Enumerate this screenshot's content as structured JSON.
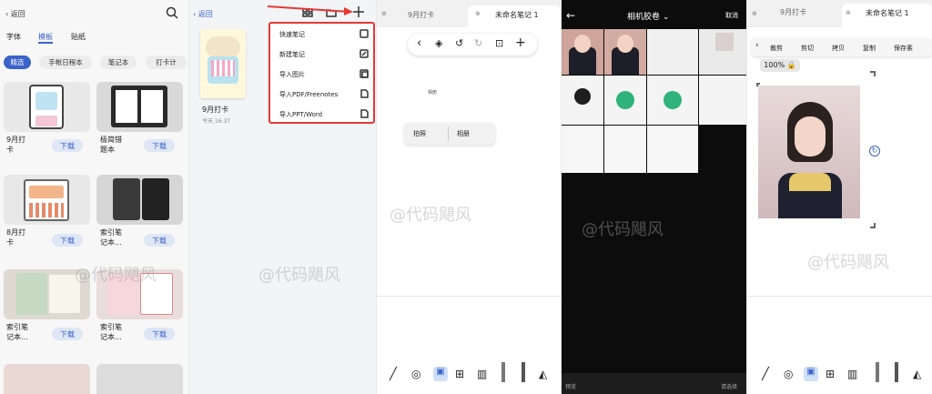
{
  "panel1": {
    "back": "返回",
    "tabs": [
      "字体",
      "模板",
      "贴纸"
    ],
    "chips": [
      "精选",
      "手帐日程本",
      "笔记本",
      "打卡计"
    ],
    "templates": [
      {
        "name": "9月打\n卡",
        "action": "下载"
      },
      {
        "name": "极简错\n题本",
        "action": "下载"
      },
      {
        "name": "8月打\n卡",
        "action": "下载"
      },
      {
        "name": "索引笔\n记本...",
        "action": "下载"
      },
      {
        "name": "索引笔\n记本...",
        "action": "下载"
      },
      {
        "name": "索引笔\n记本...",
        "action": "下载"
      }
    ]
  },
  "panel2": {
    "back": "返回",
    "note_title": "9月打卡",
    "note_time": "今天 16:37",
    "menu": [
      "快速笔记",
      "新建笔记",
      "导入图片",
      "导入PDF/Freenotes",
      "导入PPT/Word"
    ]
  },
  "panel3": {
    "tabs": [
      "9月打卡",
      "未命名笔记 1"
    ],
    "pop": [
      "拍照",
      "相册"
    ],
    "small_text": "相册"
  },
  "panel4": {
    "title": "相机胶卷",
    "cancel": "取消",
    "bottom_left": "预览",
    "bottom_right": "请选择"
  },
  "panel5": {
    "tabs": [
      "9月打卡",
      "未命名笔记 1"
    ],
    "tools": [
      "裁剪",
      "剪切",
      "拷贝",
      "复制",
      "保存素"
    ],
    "zoom": "100%"
  },
  "watermark": "@代码飓风",
  "colors": {
    "accent": "#3a62c9",
    "menu_border": "#e53935",
    "chip_active": "#3a62c9"
  }
}
